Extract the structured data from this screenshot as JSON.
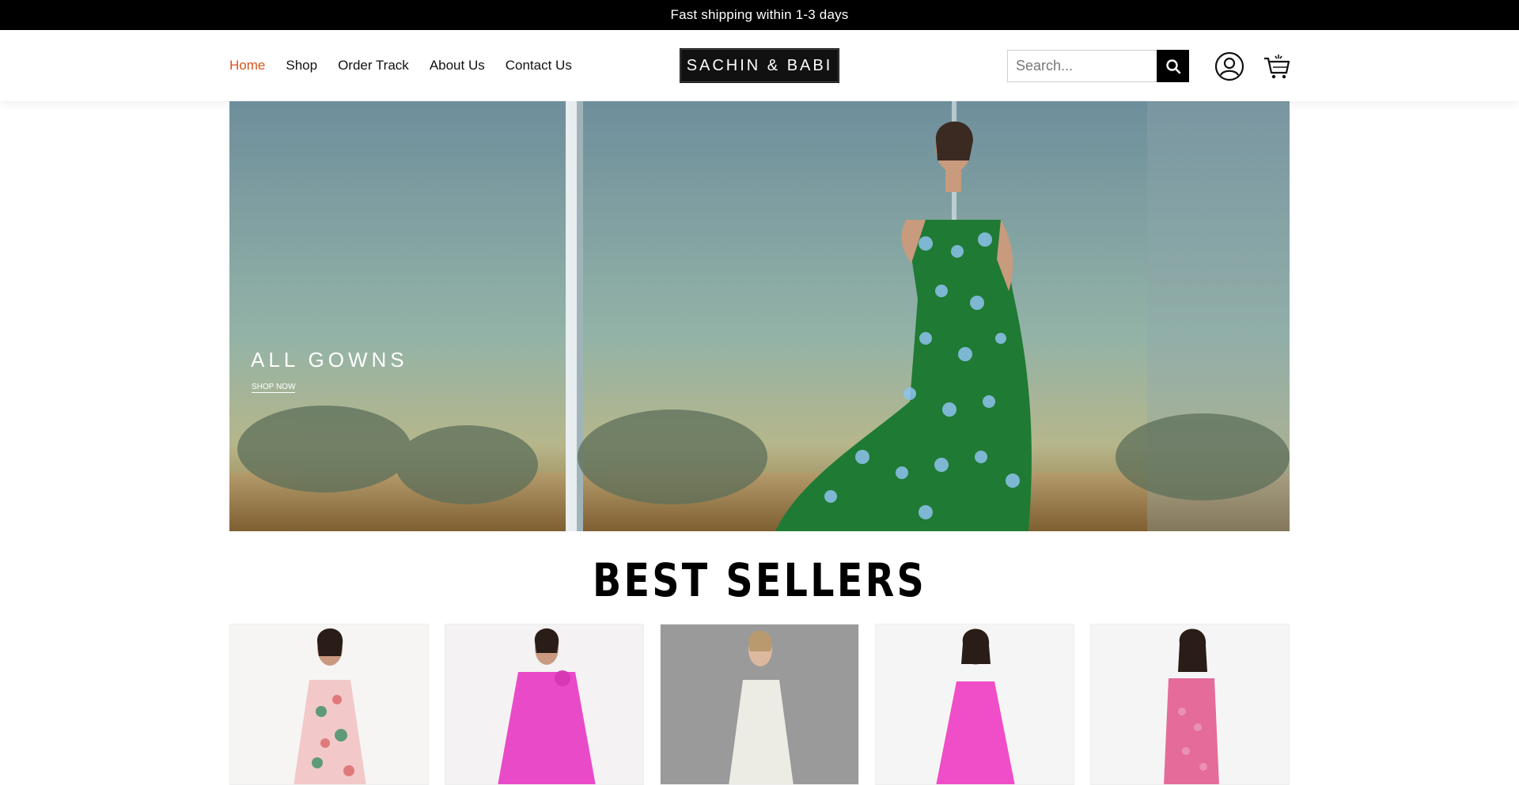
{
  "announcement": {
    "text": "Fast shipping within 1-3 days"
  },
  "nav": {
    "items": [
      {
        "label": "Home",
        "active": true
      },
      {
        "label": "Shop",
        "active": false
      },
      {
        "label": "Order Track",
        "active": false
      },
      {
        "label": "About Us",
        "active": false
      },
      {
        "label": "Contact Us",
        "active": false
      }
    ]
  },
  "brand": {
    "logo_text": "SACHIN & BABI"
  },
  "search": {
    "placeholder": "Search..."
  },
  "icons": {
    "search": "search-icon",
    "account": "user-circle-icon",
    "cart": "shopping-cart-icon"
  },
  "hero": {
    "title": "ALL GOWNS",
    "cta": "SHOP NOW"
  },
  "best_sellers": {
    "title": "BEST SELLERS",
    "products": [
      {
        "image": "floral-print-dress",
        "dress_color": "#f2c9c8"
      },
      {
        "image": "fuchsia-cape-gown",
        "dress_color": "#e94ac8"
      },
      {
        "image": "ivory-strapless-gown",
        "dress_color": "#ecebe4"
      },
      {
        "image": "fuchsia-strapless-gown",
        "dress_color": "#f04dc8"
      },
      {
        "image": "pink-lace-dress",
        "dress_color": "#e46b9a"
      }
    ]
  },
  "colors": {
    "accent": "#d8541d",
    "announcement_bg": "#000000"
  }
}
